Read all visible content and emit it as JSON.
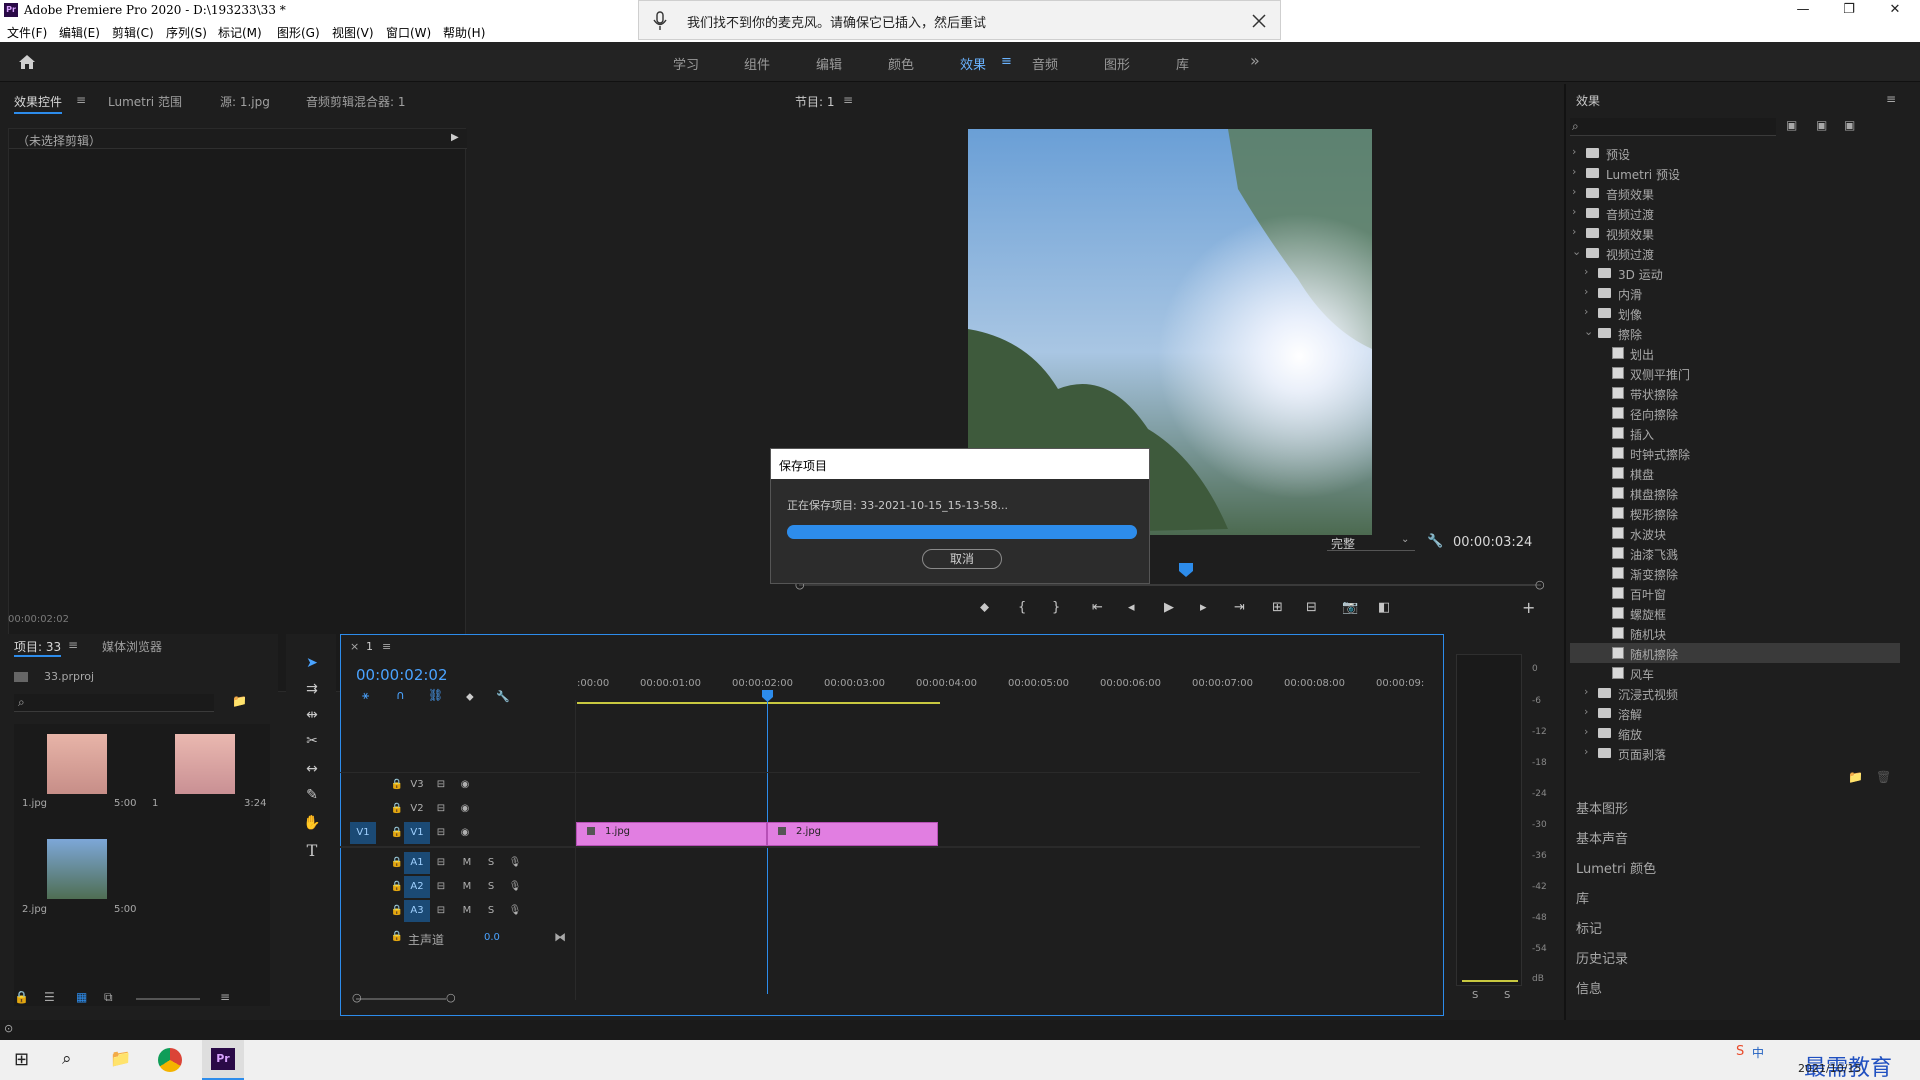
{
  "titlebar": {
    "app_icon": "Pr",
    "title": "Adobe Premiere Pro 2020 - D:\\193233\\33 *",
    "minimize": "—",
    "maximize": "❐",
    "close": "✕"
  },
  "menu": [
    "文件(F)",
    "编辑(E)",
    "剪辑(C)",
    "序列(S)",
    "标记(M)",
    "图形(G)",
    "视图(V)",
    "窗口(W)",
    "帮助(H)"
  ],
  "notification": {
    "text": "我们找不到你的麦克风。请确保它已插入，然后重试",
    "icon": "microphone-icon"
  },
  "workspaces": {
    "items": [
      "学习",
      "组件",
      "编辑",
      "颜色",
      "效果",
      "音频",
      "图形",
      "库"
    ],
    "active": "效果",
    "more": "»"
  },
  "effect_controls": {
    "tabs": [
      "效果控件",
      "Lumetri 范围",
      "源: 1.jpg",
      "音频剪辑混合器: 1"
    ],
    "no_clip": "（未选择剪辑）",
    "timecode": "00:00:02:02"
  },
  "program": {
    "title": "节目: 1",
    "fit": "完整",
    "timecode": "00:00:03:24"
  },
  "save_dialog": {
    "title": "保存项目",
    "message": "正在保存项目: 33-2021-10-15_15-13-58...",
    "progress": 1.0,
    "cancel": "取消"
  },
  "project": {
    "tabs": [
      "项目: 33",
      "媒体浏览器"
    ],
    "file": "33.prproj",
    "items": [
      {
        "name": "1.jpg",
        "dur": "5:00"
      },
      {
        "name": "1",
        "dur": "3:24"
      },
      {
        "name": "2.jpg",
        "dur": "5:00"
      }
    ]
  },
  "timeline": {
    "tab": "1",
    "timecode": "00:00:02:02",
    "ruler": [
      ":00:00",
      "00:00:01:00",
      "00:00:02:00",
      "00:00:03:00",
      "00:00:04:00",
      "00:00:05:00",
      "00:00:06:00",
      "00:00:07:00",
      "00:00:08:00",
      "00:00:09:"
    ],
    "video_tracks": [
      "V3",
      "V2",
      "V1"
    ],
    "audio_tracks": [
      "A1",
      "A2",
      "A3"
    ],
    "source_v": "V1",
    "master": "主声道",
    "master_val": "0.0",
    "clips": [
      "1.jpg",
      "2.jpg"
    ],
    "mute": "M",
    "solo": "S"
  },
  "meter": {
    "labels": [
      "0",
      "-6",
      "-12",
      "-18",
      "-24",
      "-30",
      "-36",
      "-42",
      "-48",
      "-54",
      "dB"
    ],
    "solo": "S"
  },
  "effects_panel": {
    "title": "效果",
    "tree": [
      {
        "label": "预设",
        "level": 0,
        "type": "folder",
        "chev": "›"
      },
      {
        "label": "Lumetri 预设",
        "level": 0,
        "type": "folder",
        "chev": "›"
      },
      {
        "label": "音频效果",
        "level": 0,
        "type": "folder",
        "chev": "›"
      },
      {
        "label": "音频过渡",
        "level": 0,
        "type": "folder",
        "chev": "›"
      },
      {
        "label": "视频效果",
        "level": 0,
        "type": "folder",
        "chev": "›"
      },
      {
        "label": "视频过渡",
        "level": 0,
        "type": "folder",
        "chev": "⌄"
      },
      {
        "label": "3D 运动",
        "level": 1,
        "type": "folder",
        "chev": "›"
      },
      {
        "label": "内滑",
        "level": 1,
        "type": "folder",
        "chev": "›"
      },
      {
        "label": "划像",
        "level": 1,
        "type": "folder",
        "chev": "›"
      },
      {
        "label": "擦除",
        "level": 1,
        "type": "folder",
        "chev": "⌄"
      },
      {
        "label": "划出",
        "level": 2,
        "type": "fx"
      },
      {
        "label": "双侧平推门",
        "level": 2,
        "type": "fx"
      },
      {
        "label": "带状擦除",
        "level": 2,
        "type": "fx"
      },
      {
        "label": "径向擦除",
        "level": 2,
        "type": "fx"
      },
      {
        "label": "插入",
        "level": 2,
        "type": "fx"
      },
      {
        "label": "时钟式擦除",
        "level": 2,
        "type": "fx"
      },
      {
        "label": "棋盘",
        "level": 2,
        "type": "fx"
      },
      {
        "label": "棋盘擦除",
        "level": 2,
        "type": "fx"
      },
      {
        "label": "楔形擦除",
        "level": 2,
        "type": "fx"
      },
      {
        "label": "水波块",
        "level": 2,
        "type": "fx"
      },
      {
        "label": "油漆飞溅",
        "level": 2,
        "type": "fx"
      },
      {
        "label": "渐变擦除",
        "level": 2,
        "type": "fx"
      },
      {
        "label": "百叶窗",
        "level": 2,
        "type": "fx"
      },
      {
        "label": "螺旋框",
        "level": 2,
        "type": "fx"
      },
      {
        "label": "随机块",
        "level": 2,
        "type": "fx"
      },
      {
        "label": "随机擦除",
        "level": 2,
        "type": "fx",
        "selected": true
      },
      {
        "label": "风车",
        "level": 2,
        "type": "fx"
      },
      {
        "label": "沉浸式视频",
        "level": 1,
        "type": "folder",
        "chev": "›"
      },
      {
        "label": "溶解",
        "level": 1,
        "type": "folder",
        "chev": "›"
      },
      {
        "label": "缩放",
        "level": 1,
        "type": "folder",
        "chev": "›"
      },
      {
        "label": "页面剥落",
        "level": 1,
        "type": "folder",
        "chev": "›"
      }
    ]
  },
  "side_panels": [
    "基本图形",
    "基本声音",
    "Lumetri 颜色",
    "库",
    "标记",
    "历史记录",
    "信息"
  ],
  "taskbar": {
    "date": "2021/10/15",
    "brand": "最需教育",
    "ime": "中"
  },
  "colors": {
    "accent": "#2d8ceb",
    "clip": "#e17ee1",
    "playhead": "#2d8ceb",
    "active_tab": "#6ab3ff"
  }
}
